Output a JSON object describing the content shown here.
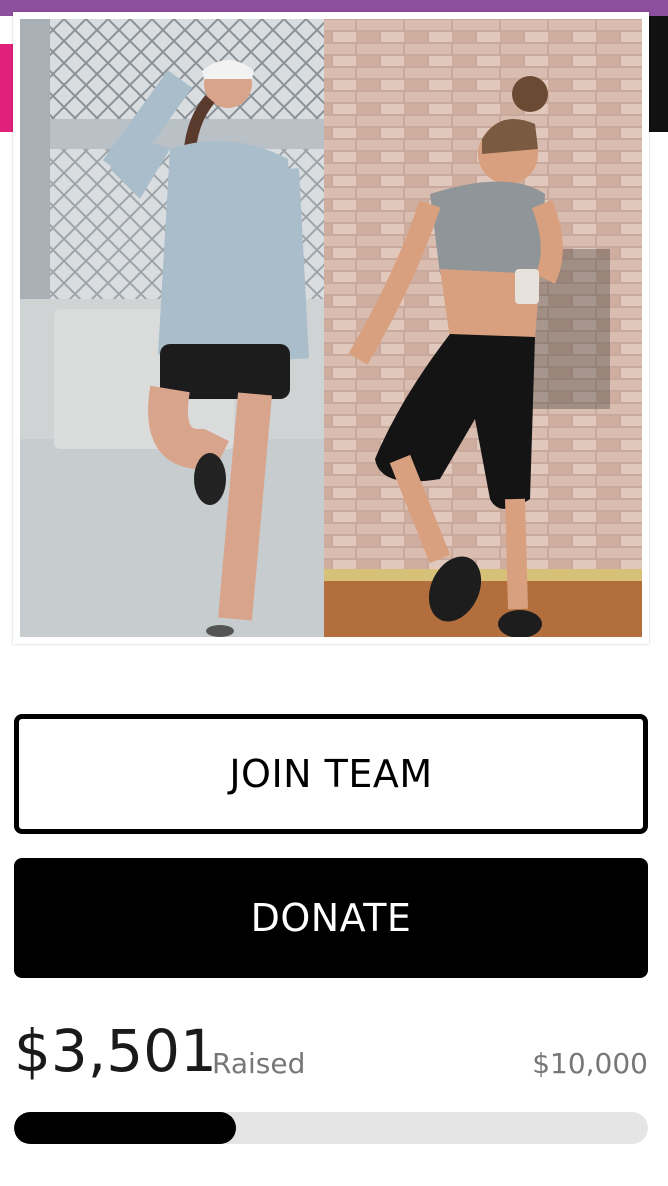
{
  "buttons": {
    "join_label": "JOIN TEAM",
    "donate_label": "DONATE"
  },
  "fundraising": {
    "raised_amount": "$3,501",
    "raised_label": "Raised",
    "goal_amount": "$10,000",
    "progress_fraction": 0.3501
  },
  "colors": {
    "brand_purple": "#8e4f9e",
    "brand_pink": "#e0207a",
    "button_dark": "#000000",
    "progress_track": "#e5e5e5"
  }
}
